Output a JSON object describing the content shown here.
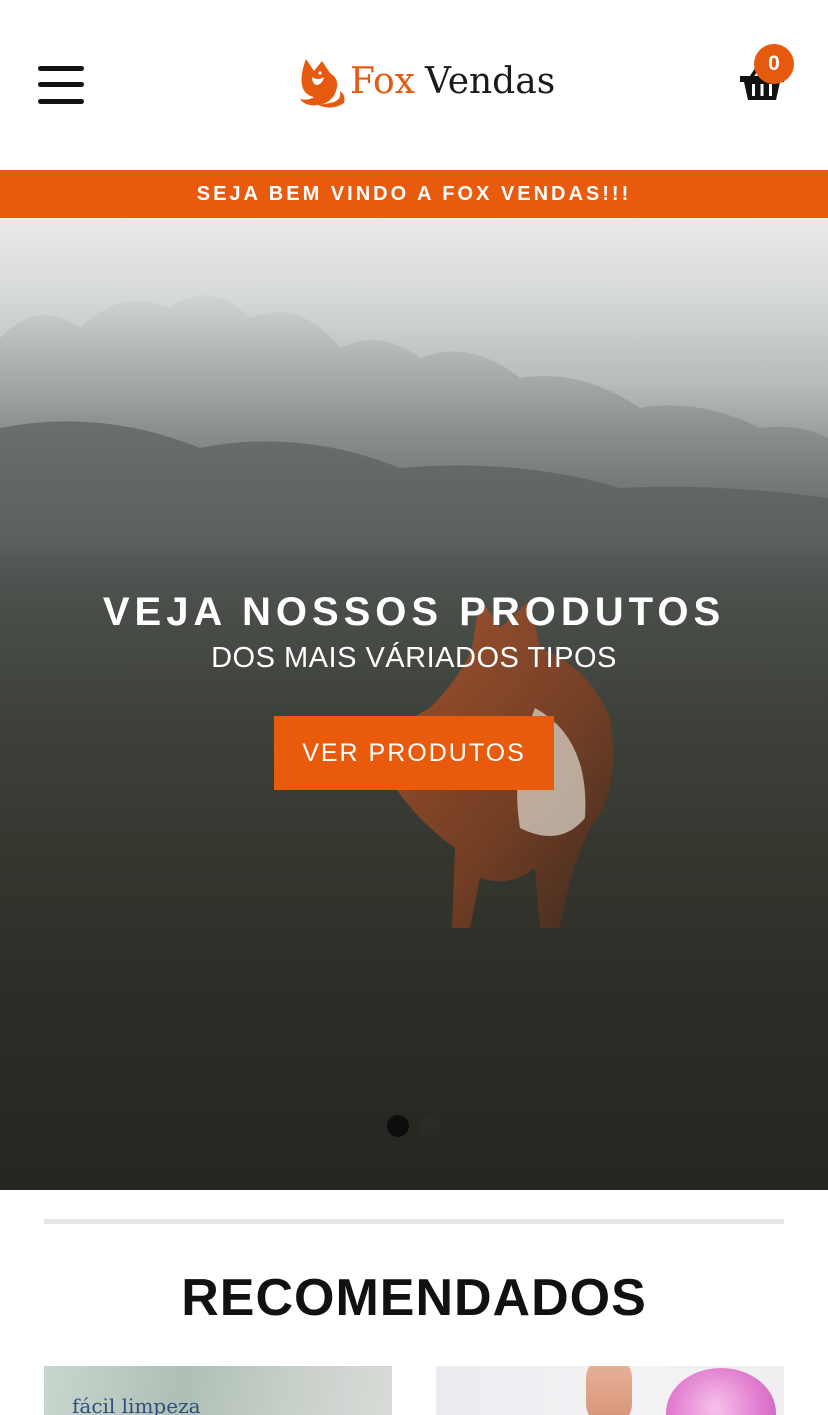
{
  "header": {
    "brand_fox": "Fox",
    "brand_vendas": "Vendas",
    "cart_count": "0",
    "accent_color": "#e85b0c"
  },
  "announcement": {
    "text": "SEJA BEM VINDO A FOX VENDAS!!!"
  },
  "hero": {
    "title": "VEJA NOSSOS PRODUTOS",
    "subtitle": "DOS MAIS VÁRIADOS TIPOS",
    "button_label": "VER PRODUTOS",
    "slides_total": 2,
    "active_slide": 1
  },
  "recommended": {
    "title": "RECOMENDADOS",
    "products": [
      {
        "thumb_text": "fácil limpeza"
      },
      {
        "thumb_text": ""
      }
    ]
  },
  "icons": {
    "menu": "hamburger-menu-icon",
    "logo": "fox-logo-icon",
    "cart": "basket-icon"
  }
}
